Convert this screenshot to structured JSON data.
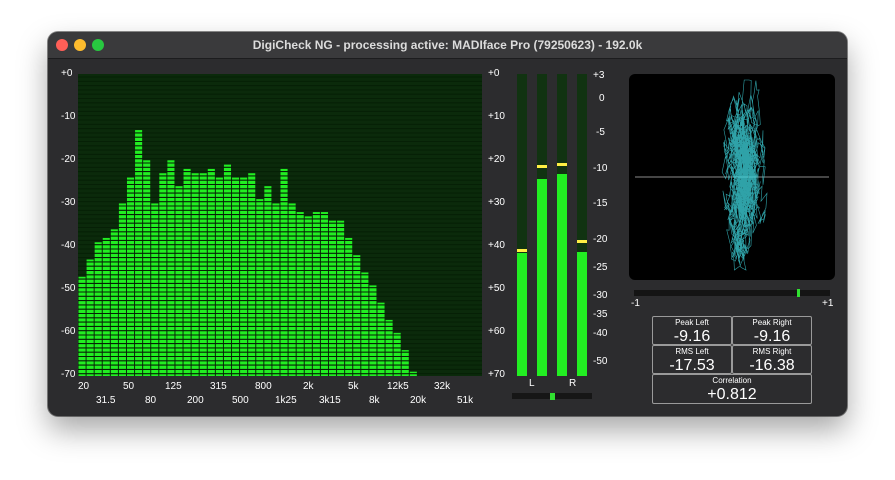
{
  "window": {
    "title": "DigiCheck NG - processing active: MADIface Pro (79250623) - 192.0k"
  },
  "spectrum": {
    "y_labels_left": [
      "+0",
      "-10",
      "-20",
      "-30",
      "-40",
      "-50",
      "-60",
      "-70"
    ],
    "y_labels_right": [
      "+0",
      "+10",
      "+20",
      "+30",
      "+40",
      "+50",
      "+60",
      "+70"
    ],
    "freq_labels_top": [
      "20",
      "50",
      "125",
      "315",
      "800",
      "2k",
      "5k",
      "12k5",
      "32k"
    ],
    "freq_labels_bottom": [
      "31.5",
      "80",
      "200",
      "500",
      "1k25",
      "3k15",
      "8k",
      "20k",
      "51k"
    ],
    "bar_levels_db": [
      -47,
      -43,
      -39,
      -38,
      -36,
      -30,
      -24,
      -13,
      -20,
      -30,
      -23,
      -20,
      -26,
      -22,
      -23,
      -23,
      -22,
      -24,
      -21,
      -24,
      -24,
      -23,
      -29,
      -26,
      -30,
      -22,
      -30,
      -32,
      -33,
      -32,
      -32,
      -34,
      -34,
      -38,
      -42,
      -46,
      -49,
      -53,
      -57,
      -60,
      -64,
      -69,
      -71,
      -71,
      -71,
      -71,
      -71,
      -71,
      -71,
      -71
    ]
  },
  "level_meter": {
    "scale_labels": [
      "+3",
      "0",
      "-5",
      "-10",
      "-15",
      "-20",
      "-25",
      "-30",
      "-35",
      "-40",
      "-50"
    ],
    "channel_labels": [
      "L",
      "R"
    ],
    "bars": [
      {
        "level_db": -22.5,
        "peak_db": -22
      },
      {
        "level_db": -11.5,
        "peak_db": -9.7
      },
      {
        "level_db": -10.9,
        "peak_db": -9.5
      },
      {
        "level_db": -22.3,
        "peak_db": -20.3
      }
    ],
    "balance": 0.5
  },
  "goniometer": {
    "scale_left": "-1",
    "scale_right": "+1",
    "correlation_indicator": 0.86
  },
  "readouts": {
    "peak_left_label": "Peak Left",
    "peak_left_value": "-9.16",
    "peak_right_label": "Peak Right",
    "peak_right_value": "-9.16",
    "rms_left_label": "RMS Left",
    "rms_left_value": "-17.53",
    "rms_right_label": "RMS Right",
    "rms_right_value": "-16.38",
    "correlation_label": "Correlation",
    "correlation_value": "+0.812"
  },
  "colors": {
    "bar_green": "#22ee22",
    "spectrum_bg": "#0b2a0b",
    "gonio_trace": "#3fd8e0",
    "window_bg": "#2c2c2e"
  }
}
